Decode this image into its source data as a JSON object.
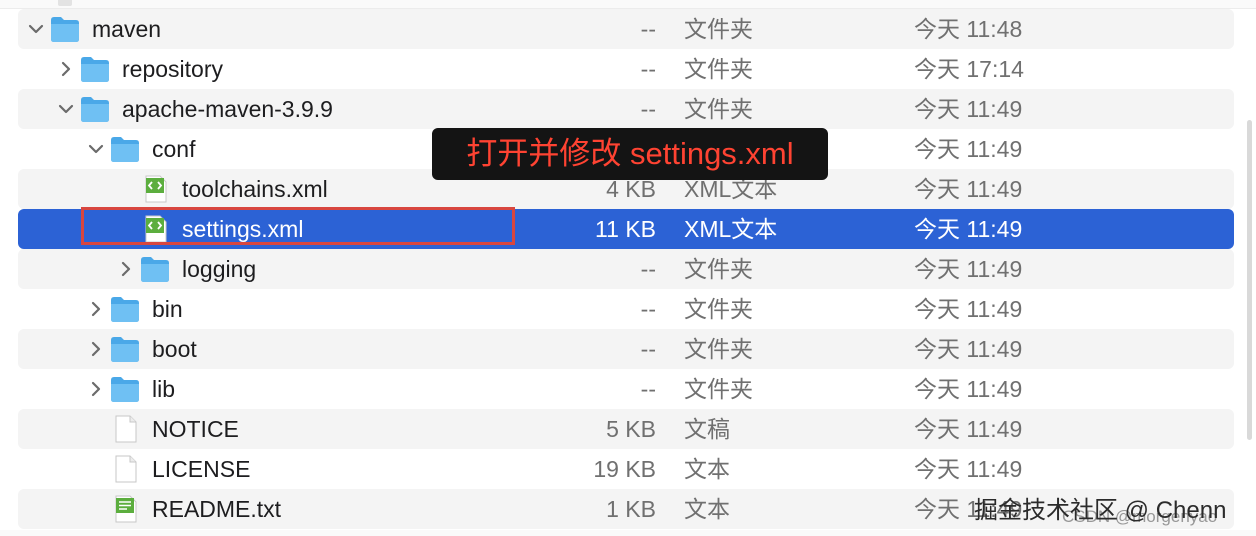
{
  "file_list": {
    "rows": [
      {
        "name": "maven",
        "size": "--",
        "kind": "文件夹",
        "date": "今天 11:48",
        "type": "folder",
        "expanded": true
      },
      {
        "name": "repository",
        "size": "--",
        "kind": "文件夹",
        "date": "今天 17:14",
        "type": "folder",
        "expanded": false
      },
      {
        "name": "apache-maven-3.9.9",
        "size": "--",
        "kind": "文件夹",
        "date": "今天 11:49",
        "type": "folder",
        "expanded": true
      },
      {
        "name": "conf",
        "size": "",
        "kind": "",
        "date": "今天 11:49",
        "type": "folder",
        "expanded": true
      },
      {
        "name": "toolchains.xml",
        "size": "4 KB",
        "kind": "XML文本",
        "date": "今天 11:49",
        "type": "xml"
      },
      {
        "name": "settings.xml",
        "size": "11 KB",
        "kind": "XML文本",
        "date": "今天 11:49",
        "type": "xml",
        "selected": true
      },
      {
        "name": "logging",
        "size": "--",
        "kind": "文件夹",
        "date": "今天 11:49",
        "type": "folder",
        "expanded": false
      },
      {
        "name": "bin",
        "size": "--",
        "kind": "文件夹",
        "date": "今天 11:49",
        "type": "folder",
        "expanded": false
      },
      {
        "name": "boot",
        "size": "--",
        "kind": "文件夹",
        "date": "今天 11:49",
        "type": "folder",
        "expanded": false
      },
      {
        "name": "lib",
        "size": "--",
        "kind": "文件夹",
        "date": "今天 11:49",
        "type": "folder",
        "expanded": false
      },
      {
        "name": "NOTICE",
        "size": "5 KB",
        "kind": "文稿",
        "date": "今天 11:49",
        "type": "doc"
      },
      {
        "name": "LICENSE",
        "size": "19 KB",
        "kind": "文本",
        "date": "今天 11:49",
        "type": "doc"
      },
      {
        "name": "README.txt",
        "size": "1 KB",
        "kind": "文本",
        "date": "今天 11:49",
        "type": "txt"
      }
    ]
  },
  "annotation": {
    "callout_text": "打开并修改 settings.xml"
  },
  "watermark": {
    "primary": "掘金技术社区 @ Chenn",
    "secondary": "CSDN @morgenyao"
  },
  "colors": {
    "selection": "#2c62d5",
    "folder": "#4aa8e8",
    "callout_text": "#ff4332",
    "callout_bg": "#141414",
    "highlight_border": "#d8463f"
  },
  "icons": {
    "folder": "folder-icon",
    "xml": "xml-file-icon",
    "doc": "document-icon",
    "txt": "text-file-icon",
    "expanded": "chevron-down-icon",
    "collapsed": "chevron-right-icon"
  }
}
